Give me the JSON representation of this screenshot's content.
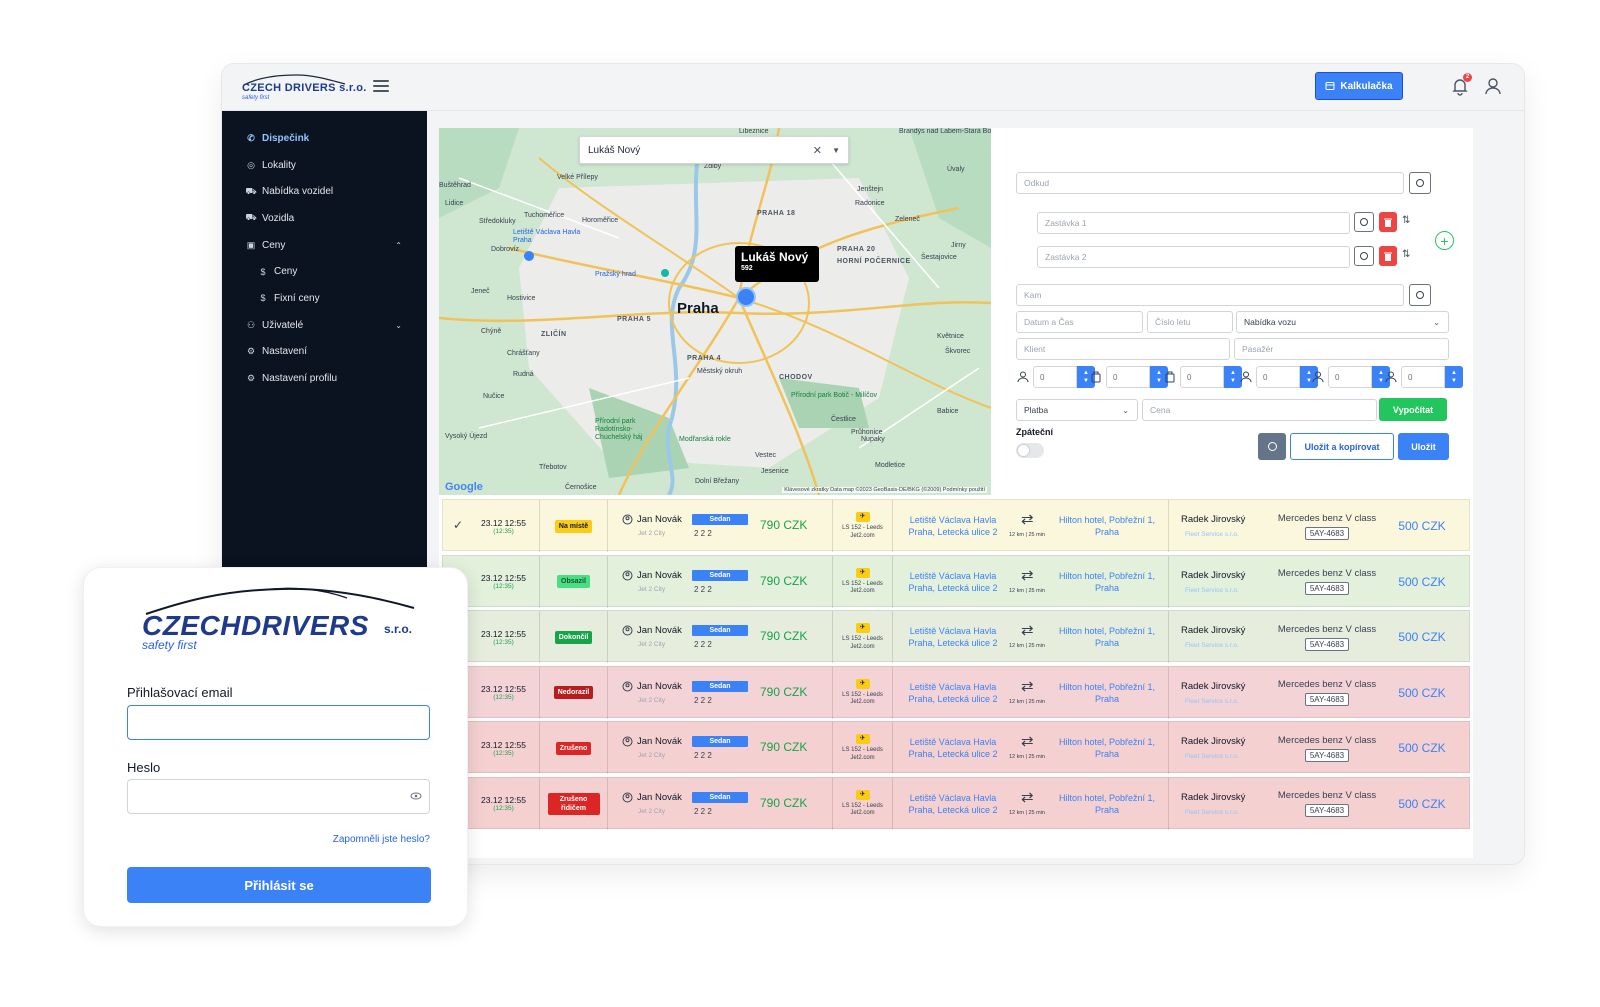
{
  "brand": {
    "name": "CZECH DRIVERS s.r.o.",
    "tagline": "safety first",
    "name_main": "CZECHDRIVERS",
    "name_suffix": "s.r.o."
  },
  "header": {
    "calc_label": "Kalkulačka",
    "notif_count": "2"
  },
  "sidebar": {
    "items": [
      {
        "label": "Dispečink",
        "icon": "phone-icon",
        "active": true
      },
      {
        "label": "Lokality",
        "icon": "compass-icon"
      },
      {
        "label": "Nabídka vozidel",
        "icon": "car-icon"
      },
      {
        "label": "Vozidla",
        "icon": "car-icon"
      },
      {
        "label": "Ceny",
        "icon": "money-icon",
        "expanded": true
      },
      {
        "label": "Ceny",
        "icon": "dollar-icon",
        "sub": true
      },
      {
        "label": "Fixní ceny",
        "icon": "dollar-icon",
        "sub": true
      },
      {
        "label": "Uživatelé",
        "icon": "users-icon",
        "collapsed": true
      },
      {
        "label": "Nastavení",
        "icon": "gear-icon"
      },
      {
        "label": "Nastavení profilu",
        "icon": "gear-icon"
      }
    ]
  },
  "map": {
    "search_value": "Lukáš Nový",
    "tooltip_name": "Lukáš Nový",
    "tooltip_code": "592",
    "city": "Praha",
    "footer": "Klávesové zkratky   Data map ©2023 GeoBasis-DE/BKG (©2009)   Podmínky použití",
    "google": "Google",
    "labels": [
      "Libeznice",
      "Brandýs nad Labem-Stará Boleslav",
      "Velké Přílepy",
      "Zdiby",
      "Klecany",
      "Úvaly",
      "Buštěhrad",
      "Lidice",
      "Tuchoměřice",
      "Horoměřice",
      "PRAHA 18",
      "Jenštejn",
      "Radonice",
      "Zeleneč",
      "Středokluky",
      "Letiště Václava Havla Praha",
      "PRAHA 20",
      "HORNÍ POČERNICE",
      "Dobrovíz",
      "Pražský hrad",
      "Šestajovice",
      "Jirny",
      "Jeneč",
      "Hostivice",
      "PRAHA 5",
      "Chýně",
      "ZLIČÍN",
      "Chrášťany",
      "Rudná",
      "Nučice",
      "Přírodní park Radotínsko-Chuchelský háj",
      "Přírodní park Botič - Milíčov",
      "CHODOV",
      "PRAHA 4",
      "Vysoký Újezd",
      "Modřanská rokle",
      "Vestec",
      "Jesenice",
      "Třebotov",
      "Černošice",
      "Dolní Břežany",
      "Modletice",
      "Průhonice",
      "Čestlice",
      "Nupaky",
      "Květnice",
      "Babice",
      "Škvorec",
      "Městský okruh"
    ]
  },
  "form": {
    "from_placeholder": "Odkud",
    "stop1": "Zastávka 1",
    "stop2": "Zastávka 2",
    "to_placeholder": "Kam",
    "date_placeholder": "Datum a Čas",
    "flight_placeholder": "Číslo letu",
    "offer_select": "Nabídka vozu",
    "client_placeholder": "Klient",
    "passenger_placeholder": "Pasažér",
    "counters": [
      "0",
      "0",
      "0",
      "0",
      "0",
      "0"
    ],
    "payment_select": "Platba",
    "price_placeholder": "Cena",
    "compute_label": "Vypočítat",
    "return_label": "Zpáteční",
    "save_copy_label": "Uložit a kopírovat",
    "save_label": "Uložit"
  },
  "rows": [
    {
      "date": "23.12  12:55",
      "time2": "(12:35)",
      "status": "Na místě",
      "status_bg": "#facc15",
      "status_fg": "#111827",
      "row_bg": "#faf7dc",
      "checked": true
    },
    {
      "date": "23.12  12:55",
      "time2": "(12:35)",
      "status": "Obsazil",
      "status_bg": "#4ade80",
      "status_fg": "#14532d",
      "row_bg": "#e3f0dc"
    },
    {
      "date": "23.12  12:55",
      "time2": "(12:35)",
      "status": "Dokončil",
      "status_bg": "#16a34a",
      "status_fg": "#ffffff",
      "row_bg": "#e6eddd"
    },
    {
      "date": "23.12  12:55",
      "time2": "(12:35)",
      "status": "Nedorazil",
      "status_bg": "#b91c1c",
      "status_fg": "#ffffff",
      "row_bg": "#f3d3d6"
    },
    {
      "date": "23.12  12:55",
      "time2": "(12:35)",
      "status": "Zrušeno",
      "status_bg": "#dc2626",
      "status_fg": "#ffffff",
      "row_bg": "#f5d0d0"
    },
    {
      "date": "23.12  12:55",
      "time2": "(12:35)",
      "status": "Zrušeno řidičem",
      "status_bg": "#dc2626",
      "status_fg": "#ffffff",
      "row_bg": "#f5d0d0"
    }
  ],
  "row_common": {
    "passenger": "Jan Novák",
    "company": "Jet 2 City",
    "car_class": "Sedan",
    "capacity": "2   2   2",
    "price": "790 CZK",
    "flight": "LS 152 - Leeds",
    "airline": "Jet2.com",
    "from": "Letiště Václava Havla Praha, Letecká ulice 2",
    "distance": "12 km | 25 min",
    "to": "Hilton hotel, Pobřežní 1, Praha",
    "driver": "Radek Jirovský",
    "fleet": "Fleet Service s.r.o.",
    "vehicle": "Mercedes benz V class",
    "plate": "5AY-4683",
    "driver_price": "500 CZK"
  },
  "login": {
    "email_label": "Přihlašovací email",
    "password_label": "Heslo",
    "forgot": "Zapomněli jste heslo?",
    "submit": "Přihlásit se"
  }
}
